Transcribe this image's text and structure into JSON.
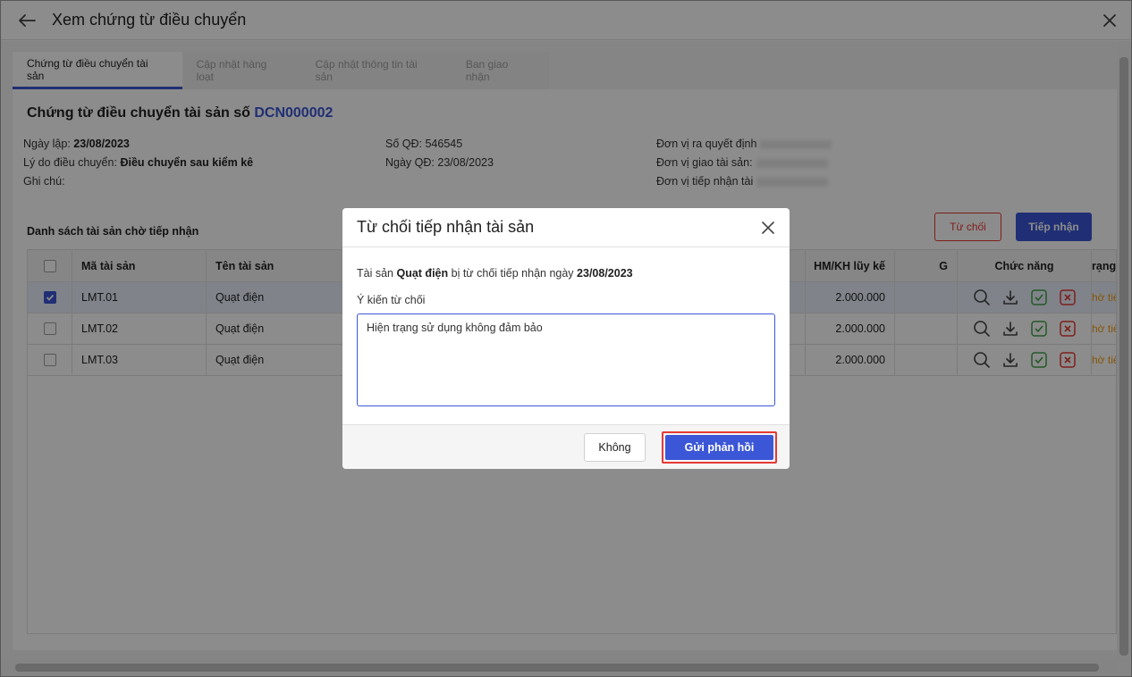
{
  "window": {
    "title": "Xem chứng từ điều chuyển"
  },
  "tabs": [
    {
      "label": "Chứng từ điều chuyển tài sản",
      "active": true
    },
    {
      "label": "Cập nhật hàng loạt",
      "active": false
    },
    {
      "label": "Cập nhật thông tin tài sản",
      "active": false
    },
    {
      "label": "Ban giao nhận",
      "active": false
    }
  ],
  "document": {
    "title_prefix": "Chứng từ điều chuyển tài sản số",
    "code": "DCN000002",
    "fields": {
      "ngay_lap_label": "Ngày lập:",
      "ngay_lap_value": "23/08/2023",
      "ly_do_label": "Lý do điều chuyển:",
      "ly_do_value": "Điều chuyển sau kiểm kê",
      "ghi_chu_label": "Ghi chú:",
      "so_qd_label": "Số QĐ:",
      "so_qd_value": "546545",
      "ngay_qd_label": "Ngày QĐ:",
      "ngay_qd_value": "23/08/2023",
      "don_vi_ra_qd_label": "Đơn vị ra quyết định",
      "don_vi_giao_label": "Đơn vị giao tài sản:",
      "don_vi_tiep_nhan_label": "Đơn vị tiếp nhận tài"
    }
  },
  "list": {
    "title": "Danh sách tài sản chờ tiếp nhận",
    "reject_label": "Từ chối",
    "accept_label": "Tiếp nhận",
    "columns": {
      "code": "Mã tài sản",
      "name": "Tên tài sản",
      "depr": "HM/KH lũy kế",
      "g": "G",
      "actions": "Chức năng",
      "status": "rạng"
    },
    "rows": [
      {
        "code": "LMT.01",
        "name": "Quạt điện",
        "depr": "2.000.000",
        "status": "hờ tiế",
        "checked": true
      },
      {
        "code": "LMT.02",
        "name": "Quạt điện",
        "depr": "2.000.000",
        "status": "hờ tiế",
        "checked": false
      },
      {
        "code": "LMT.03",
        "name": "Quạt điện",
        "depr": "2.000.000",
        "status": "hờ tiế",
        "checked": false
      }
    ]
  },
  "modal": {
    "title": "Từ chối tiếp nhận tài sản",
    "msg_prefix": "Tài sản",
    "msg_asset": "Quạt điện",
    "msg_middle": "bị từ chối tiếp nhận ngày",
    "msg_date": "23/08/2023",
    "reason_label": "Ý kiến từ chối",
    "reason_value": "Hiện trạng sử dụng không đảm bảo",
    "cancel_label": "Không",
    "submit_label": "Gửi phản hồi"
  },
  "colors": {
    "accent": "#3b56d6",
    "danger": "#e53935",
    "status": "#f39c12",
    "check_green": "#43a047"
  }
}
